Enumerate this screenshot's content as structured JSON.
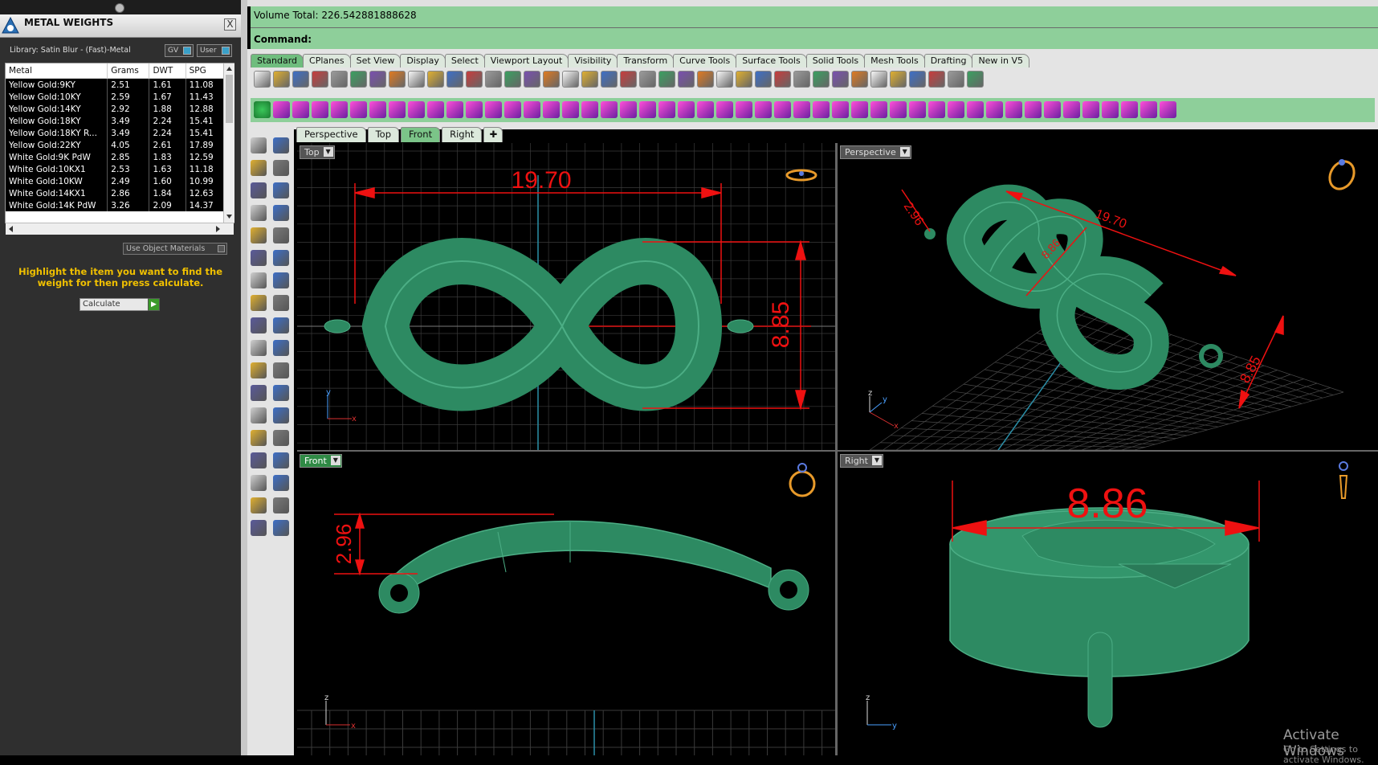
{
  "metal_panel": {
    "title": "METAL WEIGHTS",
    "close_label": "X",
    "library": "Library: Satin Blur - (Fast)-Metal",
    "gv_label": "GV",
    "user_label": "User",
    "columns": [
      "Metal",
      "Grams",
      "DWT",
      "SPG"
    ],
    "rows": [
      [
        "Yellow Gold:9KY",
        "2.51",
        "1.61",
        "11.08"
      ],
      [
        "Yellow Gold:10KY",
        "2.59",
        "1.67",
        "11.43"
      ],
      [
        "Yellow Gold:14KY",
        "2.92",
        "1.88",
        "12.88"
      ],
      [
        "Yellow Gold:18KY",
        "3.49",
        "2.24",
        "15.41"
      ],
      [
        "Yellow Gold:18KY R...",
        "3.49",
        "2.24",
        "15.41"
      ],
      [
        "Yellow Gold:22KY",
        "4.05",
        "2.61",
        "17.89"
      ],
      [
        "White Gold:9K PdW",
        "2.85",
        "1.83",
        "12.59"
      ],
      [
        "White Gold:10KX1",
        "2.53",
        "1.63",
        "11.18"
      ],
      [
        "White Gold:10KW",
        "2.49",
        "1.60",
        "10.99"
      ],
      [
        "White Gold:14KX1",
        "2.86",
        "1.84",
        "12.63"
      ],
      [
        "White Gold:14K PdW",
        "3.26",
        "2.09",
        "14.37"
      ]
    ],
    "use_object_materials": "Use Object Materials",
    "instruction": "Highlight the item you want to find the weight for then press calculate.",
    "calculate_label": "Calculate"
  },
  "command_area": {
    "volume_text": "Volume Total: 226.542881888628",
    "command_label": "Command:"
  },
  "toolbar_tabs": [
    "Standard",
    "CPlanes",
    "Set View",
    "Display",
    "Select",
    "Viewport Layout",
    "Visibility",
    "Transform",
    "Curve Tools",
    "Surface Tools",
    "Solid Tools",
    "Mesh Tools",
    "Drafting",
    "New in V5"
  ],
  "viewport_tabs": [
    "Perspective",
    "Top",
    "Front",
    "Right"
  ],
  "viewports": {
    "top": {
      "label": "Top",
      "dim_width": "19.70",
      "dim_height": "8.85"
    },
    "perspective": {
      "label": "Perspective",
      "dim_a": "2.96",
      "dim_b": "19.70",
      "dim_c": "8.85",
      "dim_d": "8.86"
    },
    "front": {
      "label": "Front",
      "dim_height": "2.96"
    },
    "right": {
      "label": "Right",
      "dim_width": "8.86"
    }
  },
  "watermark": {
    "line1": "Activate Windows",
    "line2": "Go to Settings to activate Windows."
  },
  "colors": {
    "model_green": "#2e8b62",
    "dimension_red": "#ee1111",
    "command_green": "#8ecf9a"
  }
}
